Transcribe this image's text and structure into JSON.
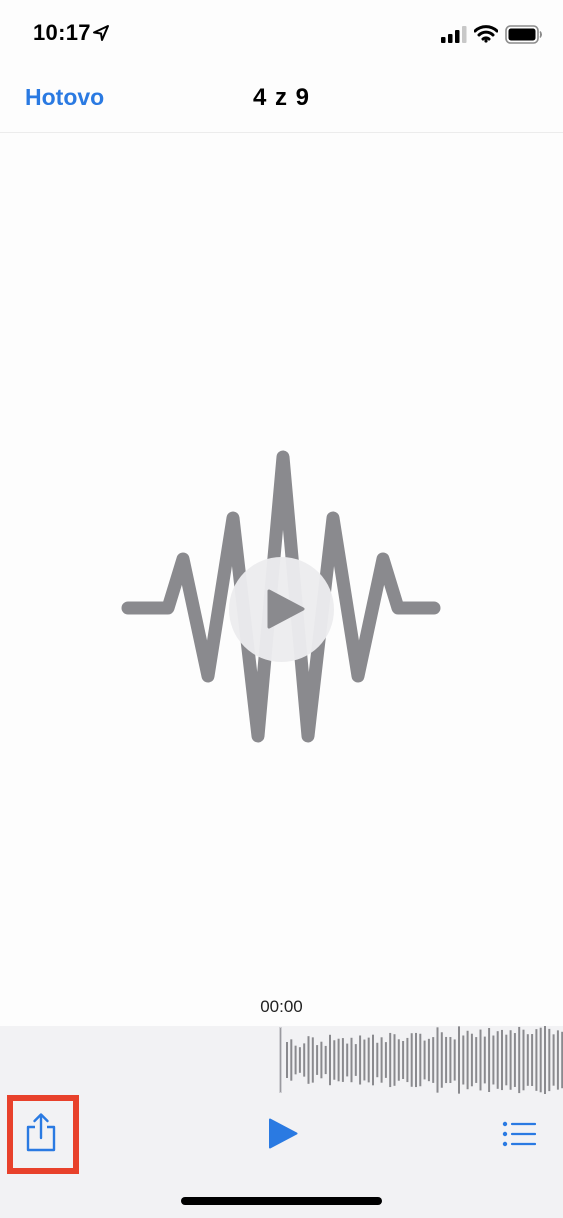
{
  "status_bar": {
    "time": "10:17",
    "icons": [
      "location-arrow-icon",
      "cellular-signal-icon",
      "wifi-icon",
      "battery-icon"
    ]
  },
  "nav": {
    "done_label": "Hotovo",
    "title": "4 z 9"
  },
  "player": {
    "artwork_icon": "audio-waveform-icon",
    "play_overlay_icon": "play-icon",
    "current_time": "00:00"
  },
  "toolbar": {
    "share_icon": "share-icon",
    "play_icon": "play-icon",
    "list_icon": "list-icon"
  },
  "colors": {
    "accent": "#2a7ae2",
    "highlight": "#e8412b",
    "waveform": "#8a8a8e",
    "panel": "#f2f2f4"
  }
}
